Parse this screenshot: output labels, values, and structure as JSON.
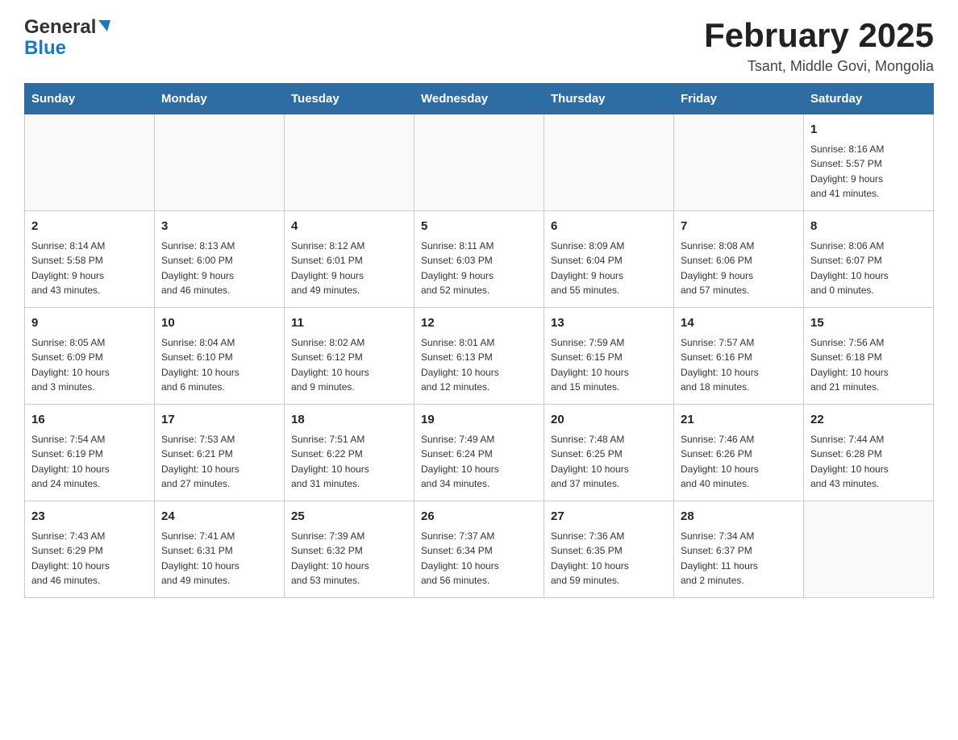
{
  "header": {
    "title": "February 2025",
    "subtitle": "Tsant, Middle Govi, Mongolia",
    "logo_general": "General",
    "logo_blue": "Blue"
  },
  "days_of_week": [
    "Sunday",
    "Monday",
    "Tuesday",
    "Wednesday",
    "Thursday",
    "Friday",
    "Saturday"
  ],
  "weeks": [
    [
      {
        "day": "",
        "info": ""
      },
      {
        "day": "",
        "info": ""
      },
      {
        "day": "",
        "info": ""
      },
      {
        "day": "",
        "info": ""
      },
      {
        "day": "",
        "info": ""
      },
      {
        "day": "",
        "info": ""
      },
      {
        "day": "1",
        "info": "Sunrise: 8:16 AM\nSunset: 5:57 PM\nDaylight: 9 hours\nand 41 minutes."
      }
    ],
    [
      {
        "day": "2",
        "info": "Sunrise: 8:14 AM\nSunset: 5:58 PM\nDaylight: 9 hours\nand 43 minutes."
      },
      {
        "day": "3",
        "info": "Sunrise: 8:13 AM\nSunset: 6:00 PM\nDaylight: 9 hours\nand 46 minutes."
      },
      {
        "day": "4",
        "info": "Sunrise: 8:12 AM\nSunset: 6:01 PM\nDaylight: 9 hours\nand 49 minutes."
      },
      {
        "day": "5",
        "info": "Sunrise: 8:11 AM\nSunset: 6:03 PM\nDaylight: 9 hours\nand 52 minutes."
      },
      {
        "day": "6",
        "info": "Sunrise: 8:09 AM\nSunset: 6:04 PM\nDaylight: 9 hours\nand 55 minutes."
      },
      {
        "day": "7",
        "info": "Sunrise: 8:08 AM\nSunset: 6:06 PM\nDaylight: 9 hours\nand 57 minutes."
      },
      {
        "day": "8",
        "info": "Sunrise: 8:06 AM\nSunset: 6:07 PM\nDaylight: 10 hours\nand 0 minutes."
      }
    ],
    [
      {
        "day": "9",
        "info": "Sunrise: 8:05 AM\nSunset: 6:09 PM\nDaylight: 10 hours\nand 3 minutes."
      },
      {
        "day": "10",
        "info": "Sunrise: 8:04 AM\nSunset: 6:10 PM\nDaylight: 10 hours\nand 6 minutes."
      },
      {
        "day": "11",
        "info": "Sunrise: 8:02 AM\nSunset: 6:12 PM\nDaylight: 10 hours\nand 9 minutes."
      },
      {
        "day": "12",
        "info": "Sunrise: 8:01 AM\nSunset: 6:13 PM\nDaylight: 10 hours\nand 12 minutes."
      },
      {
        "day": "13",
        "info": "Sunrise: 7:59 AM\nSunset: 6:15 PM\nDaylight: 10 hours\nand 15 minutes."
      },
      {
        "day": "14",
        "info": "Sunrise: 7:57 AM\nSunset: 6:16 PM\nDaylight: 10 hours\nand 18 minutes."
      },
      {
        "day": "15",
        "info": "Sunrise: 7:56 AM\nSunset: 6:18 PM\nDaylight: 10 hours\nand 21 minutes."
      }
    ],
    [
      {
        "day": "16",
        "info": "Sunrise: 7:54 AM\nSunset: 6:19 PM\nDaylight: 10 hours\nand 24 minutes."
      },
      {
        "day": "17",
        "info": "Sunrise: 7:53 AM\nSunset: 6:21 PM\nDaylight: 10 hours\nand 27 minutes."
      },
      {
        "day": "18",
        "info": "Sunrise: 7:51 AM\nSunset: 6:22 PM\nDaylight: 10 hours\nand 31 minutes."
      },
      {
        "day": "19",
        "info": "Sunrise: 7:49 AM\nSunset: 6:24 PM\nDaylight: 10 hours\nand 34 minutes."
      },
      {
        "day": "20",
        "info": "Sunrise: 7:48 AM\nSunset: 6:25 PM\nDaylight: 10 hours\nand 37 minutes."
      },
      {
        "day": "21",
        "info": "Sunrise: 7:46 AM\nSunset: 6:26 PM\nDaylight: 10 hours\nand 40 minutes."
      },
      {
        "day": "22",
        "info": "Sunrise: 7:44 AM\nSunset: 6:28 PM\nDaylight: 10 hours\nand 43 minutes."
      }
    ],
    [
      {
        "day": "23",
        "info": "Sunrise: 7:43 AM\nSunset: 6:29 PM\nDaylight: 10 hours\nand 46 minutes."
      },
      {
        "day": "24",
        "info": "Sunrise: 7:41 AM\nSunset: 6:31 PM\nDaylight: 10 hours\nand 49 minutes."
      },
      {
        "day": "25",
        "info": "Sunrise: 7:39 AM\nSunset: 6:32 PM\nDaylight: 10 hours\nand 53 minutes."
      },
      {
        "day": "26",
        "info": "Sunrise: 7:37 AM\nSunset: 6:34 PM\nDaylight: 10 hours\nand 56 minutes."
      },
      {
        "day": "27",
        "info": "Sunrise: 7:36 AM\nSunset: 6:35 PM\nDaylight: 10 hours\nand 59 minutes."
      },
      {
        "day": "28",
        "info": "Sunrise: 7:34 AM\nSunset: 6:37 PM\nDaylight: 11 hours\nand 2 minutes."
      },
      {
        "day": "",
        "info": ""
      }
    ]
  ]
}
